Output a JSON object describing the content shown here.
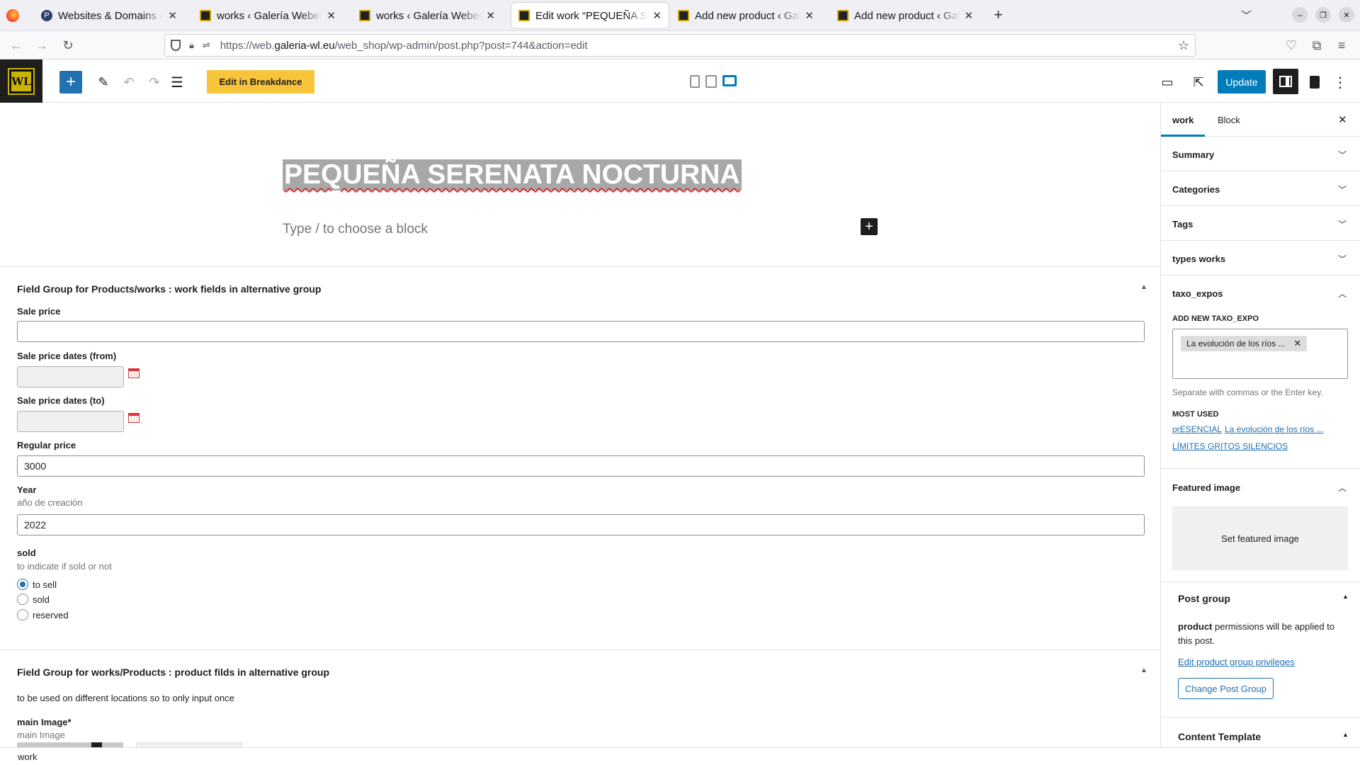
{
  "browser": {
    "tabs": [
      {
        "title": "Websites & Domains - Plesk",
        "active": false
      },
      {
        "title": "works ‹ Galería Weber-Lutz",
        "active": false
      },
      {
        "title": "works ‹ Galería Weber-Lutz",
        "active": false
      },
      {
        "title": "Edit work “PEQUEÑA SERENATA",
        "active": true
      },
      {
        "title": "Add new product ‹ Galería",
        "active": false
      },
      {
        "title": "Add new product ‹ Galería",
        "active": false
      }
    ],
    "url_prefix": "https://web.",
    "url_domain": "galeria-wl.eu",
    "url_path": "/web_shop/wp-admin/post.php?post=744&action=edit"
  },
  "toolbar": {
    "breakdance_label": "Edit in Breakdance",
    "update_label": "Update",
    "accent": "#007cba",
    "breakdance_color": "#f8c43a"
  },
  "editor": {
    "title": "PEQUEÑA SERENATA NOCTURNA",
    "block_placeholder": "Type / to choose a block"
  },
  "field_group_1": {
    "heading": "Field Group for Products/works : work fields in alternative group",
    "sale_price_label": "Sale price",
    "sale_price_value": "",
    "sale_from_label": "Sale price dates (from)",
    "sale_to_label": "Sale price dates (to)",
    "regular_price_label": "Regular price",
    "regular_price_value": "3000",
    "year_label": "Year",
    "year_desc": "año de creación",
    "year_value": "2022",
    "sold_label": "sold",
    "sold_desc": "to indicate if sold or not",
    "sold_options": [
      {
        "label": "to sell",
        "checked": true
      },
      {
        "label": "sold",
        "checked": false
      },
      {
        "label": "reserved",
        "checked": false
      }
    ]
  },
  "field_group_2": {
    "heading": "Field Group for works/Products : product filds in alternative group",
    "desc": "to be used on different locations so to only input once",
    "main_image_label": "main Image*",
    "main_image_desc": "main Image"
  },
  "sidebar": {
    "tab_work": "work",
    "tab_block": "Block",
    "panels": {
      "summary": "Summary",
      "categories": "Categories",
      "tags": "Tags",
      "types_works": "types works",
      "taxo_expos": "taxo_expos"
    },
    "taxo": {
      "add_new_label": "ADD NEW TAXO_EXPO",
      "token": "La evolución de los ríos ...",
      "help": "Separate with commas or the Enter key.",
      "most_used_label": "MOST USED",
      "most_used": [
        "prESENCIAL",
        "La evolución de los ríos ...",
        "LÍMITES GRITOS SILENCIOS"
      ]
    },
    "featured": {
      "title": "Featured image",
      "button": "Set featured image"
    },
    "post_group": {
      "title": "Post group",
      "text_bold": "product",
      "text_rest": " permissions will be applied to this post.",
      "link": "Edit product group privileges",
      "button": "Change Post Group"
    },
    "content_template": {
      "title": "Content Template"
    }
  },
  "footer": {
    "breadcrumb": "work"
  }
}
